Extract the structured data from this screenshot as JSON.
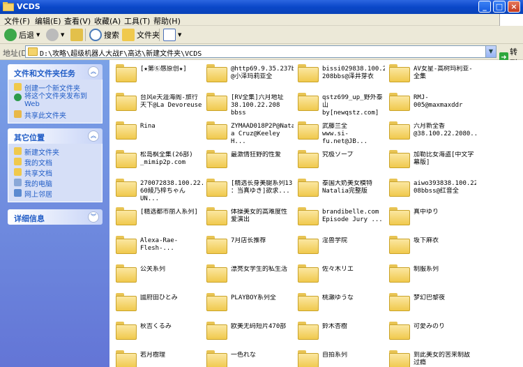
{
  "window": {
    "title": "VCDS",
    "minimize": "_",
    "maximize": "□",
    "close": "×"
  },
  "menu": [
    "文件(F)",
    "编辑(E)",
    "查看(V)",
    "收藏(A)",
    "工具(T)",
    "帮助(H)"
  ],
  "toolbar": {
    "back": "后退",
    "search": "搜索",
    "folders": "文件夹"
  },
  "address": {
    "label": "地址(D)",
    "path": "D:\\攻略\\超级机器人大战F\\高达\\新建文件夹\\VCDS",
    "go": "转到"
  },
  "sidebar": {
    "file_tasks": {
      "title": "文件和文件夹任务",
      "items": [
        "创建一个新文件夹",
        "将这个文件夹发布到\nWeb",
        "共享此文件夹"
      ]
    },
    "other_places": {
      "title": "其它位置",
      "items": [
        "新建文件夹",
        "我的文档",
        "共享文档",
        "我的电脑",
        "网上邻居"
      ]
    },
    "details": {
      "title": "详细信息"
    }
  },
  "folders": [
    "[★第⑥感原创★]",
    "@http69.9.35.237bbs\n@小泽玛莉亚全",
    "bissi029838.100.22.\n208bbs@泽井芽衣",
    "AV女星-高树玛利亚-\n全集",
    "台风e天涯海阁-旅行\n天下@La Devoreuse",
    "[RV全集]六月地址\n38.100.22.208 bbss",
    "qstz699_up_野外泰山\nby[newqstz.com]",
    "RMJ-005@maxmaxddr",
    "Rina",
    "ZYMAAD018P2P@Natali\na Cruz@Keeley H...",
    "武藤兰全\nwww.si-fu.net@JB...",
    "六月新全香\n@38.100.22.2080...",
    "松岛枫全集(26部)\n_mimip2p.com",
    "最激情狂野的性爱",
    "究极ソープ",
    "加勒比女海盗[中文字\n幕版]",
    "270072838.100.22.15\n60綾乃梓ちゃん UN...",
    "[精选长身美腿系列13\n：当真ゆき]欲求...",
    "泰国大奶美女模特\nNatalia完整版",
    "aiwo393838.100.22.2\n08bbss@红音全",
    "[精选都市丽人系列]",
    "体操美女的高难度性\n爱演出",
    "brandibelle.com\nEpisode Jury ...",
    "真中ゆり",
    "Alexa-Rae-Flesh-...",
    "7月店长推荐",
    "淫兽学院",
    "坂下麻衣",
    "公关系列",
    "漂亮女学生的私生活",
    "佐々木リエ",
    "制服系列",
    "國府田ひとみ",
    "PLAYBOY系列全",
    "桃瀬ゆうな",
    "梦幻巴黎夜",
    "秋吉くるみ",
    "欧美无码短片470部",
    "鈴木杏樹",
    "可愛みのり",
    "若月樹理",
    "一色れな",
    "自拍系列",
    "到此美女的苦来制敌\n过瘾"
  ],
  "colors": {
    "titlebar": "#0a47c9",
    "sidebar": "#6f8fe0",
    "task_link": "#215dc6",
    "chrome": "#ece9d8"
  }
}
